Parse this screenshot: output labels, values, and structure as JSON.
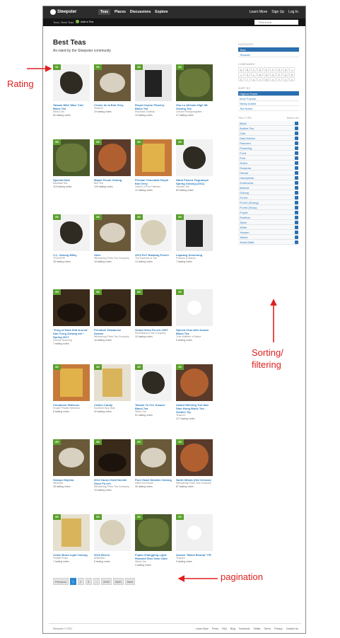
{
  "header": {
    "logo": "Steepster",
    "nav": [
      "Teas",
      "Places",
      "Discussions",
      "Explore"
    ],
    "user_nav": [
      "Learn More",
      "Sign Up",
      "Log In"
    ],
    "breadcrumb": "Teas / Best Teas",
    "add_tea": "Add a Tea",
    "search_placeholder": "Find a tea..."
  },
  "page": {
    "title": "Best Teas",
    "subtitle": "As rated by the Steepster community"
  },
  "teas": [
    {
      "rating": "91",
      "name": "Taiwan Wild 'Mao' Cha' Black Tea",
      "brand": "What-Cha",
      "notes": "60 tasting notes",
      "style": "t-leaf"
    },
    {
      "rating": "90",
      "name": "Creme de la Earl Grey",
      "brand": "Teavivre",
      "notes": "19 tasting notes",
      "style": "t-bowl"
    },
    {
      "rating": "89",
      "name": "Royal Ceylon Flowery Black Tea",
      "brand": "Elephant Chateau",
      "notes": "10 tasting notes",
      "style": "t-tin"
    },
    {
      "rating": "89",
      "name": "Zhu Lu Alishan High Mt. Oolong Tea",
      "brand": "Unicorn Rongcongskies",
      "notes": "27 tasting notes",
      "style": "t-green"
    },
    {
      "rating": "89",
      "name": "Special Dark",
      "brand": "Mandala Tea",
      "notes": "115 tasting notes",
      "style": "t-green"
    },
    {
      "rating": "89",
      "name": "Maple Pecan Oolong",
      "brand": "Bird Tea",
      "notes": "109 tasting notes",
      "style": "t-tea"
    },
    {
      "rating": "89",
      "name": "Persian Chocolate Royal Earl Grey",
      "brand": "Heart's of Tea Pakistan",
      "notes": "12 tasting notes",
      "style": "t-box"
    },
    {
      "rating": "89",
      "name": "Hand Picked Tieguanyin Spring Oolong (2011)",
      "brand": "Verdant Tea",
      "notes": "89 tasting notes",
      "style": "t-leaf"
    },
    {
      "rating": "89",
      "name": "J.C. Oolong Milky",
      "brand": "TEAVIVRE",
      "notes": "18 tasting notes",
      "style": "t-leaf"
    },
    {
      "rating": "89",
      "name": "Alice",
      "brand": "Whispering Pines Tea Company",
      "notes": "18 tasting notes",
      "style": "t-bowl"
    },
    {
      "rating": "89",
      "name": "2012 EoT Bastang Punch",
      "brand": "The Essence of Tea",
      "notes": "14 tasting notes",
      "style": "t-cake"
    },
    {
      "rating": "89",
      "name": "Lapsang Souchong",
      "brand": "Fortnum & Mason",
      "notes": "7 tasting notes",
      "style": "t-tin"
    },
    {
      "rating": "89",
      "name": "\"King of Dark Shit Aroma\" Dan Cong Oolong tea * Spring 2017",
      "brand": "Yunnan Sourcing",
      "notes": "7 tasting notes",
      "style": "t-dark"
    },
    {
      "rating": "89",
      "name": "Premium Taiwanese Assam",
      "brand": "Whispering Pines Tea Company",
      "notes": "18 tasting notes",
      "style": "t-dark"
    },
    {
      "rating": "89",
      "name": "Grand Shou Pu-erh 1997",
      "brand": "Red Blossom Tea Company",
      "notes": "10 tasting notes",
      "style": "t-dark"
    },
    {
      "rating": "89",
      "name": "Spiced Chai with Assam Black Tea",
      "brand": "Char Walletts of Maine",
      "notes": "5 tasting notes",
      "style": "t-blank"
    },
    {
      "rating": "89",
      "name": "Cinnamon Hibiscus",
      "brand": "Kroger Private Selection",
      "notes": "8 tasting notes",
      "style": "t-box"
    },
    {
      "rating": "89",
      "name": "Cotton Candy",
      "brand": "Southern Boy Teas",
      "notes": "30 tasting notes",
      "style": "t-pack"
    },
    {
      "rating": "89",
      "name": "Taiwan Yu Chi 'Assam' Black Tea",
      "brand": "What-Cha",
      "notes": "51 tasting notes",
      "style": "t-leaf"
    },
    {
      "rating": "89",
      "name": "Award Winning Yun Nan Dian Hong Black Tea - Golden Tip",
      "brand": "Teavivre",
      "notes": "117 tasting notes",
      "style": "t-tea"
    },
    {
      "rating": "89",
      "name": "Gokujo Hojicha",
      "brand": "Hibiscuts",
      "notes": "28 tasting notes",
      "style": "t-bowl"
    },
    {
      "rating": "89",
      "name": "2012 Huron Gold Needle Shou Pu-erh",
      "brand": "Whispering Pines Tea Company",
      "notes": "15 tasting notes",
      "style": "t-dark"
    },
    {
      "rating": "89",
      "name": "Pure Heart Shizhen Oolong",
      "brand": "Adita Tea House",
      "notes": "30 tasting notes",
      "style": "t-bowl"
    },
    {
      "rating": "89",
      "name": "North Winds (Old Version)",
      "brand": "Whispering Pines Tea Company",
      "notes": "87 tasting notes",
      "style": "t-tea"
    },
    {
      "rating": "89",
      "name": "Crane Bond Light Oolong",
      "brand": "Temple Road",
      "notes": "7 tasting notes",
      "style": "t-pack"
    },
    {
      "rating": "89",
      "name": "2016 Beech",
      "brand": "white2tea",
      "notes": "6 tasting notes",
      "style": "t-cake"
    },
    {
      "rating": "89",
      "name": "Fujian Zhangping Light Roasted Shui Xian Cake",
      "brand": "What-Cha",
      "notes": "3 tasting notes",
      "style": "t-green"
    },
    {
      "rating": "89",
      "name": "Assam \"Black Beauty\" FR",
      "brand": "Teapure",
      "notes": "9 tasting notes",
      "style": "t-blank"
    }
  ],
  "sidebar": {
    "category_head": "CATEGORY",
    "categories": [
      {
        "label": "Teas",
        "active": true
      },
      {
        "label": "Teaware",
        "active": false
      }
    ],
    "companies_head": "COMPANIES",
    "letters": [
      "A",
      "B",
      "C",
      "D",
      "E",
      "F",
      "G",
      "H",
      "I",
      "J",
      "K",
      "L",
      "M",
      "N",
      "O",
      "P",
      "Q",
      "R",
      "S",
      "T",
      "U",
      "V",
      "W",
      "X",
      "Y",
      "Z",
      "#"
    ],
    "sort_head": "SORT BY",
    "sort": [
      {
        "label": "Highest Rated",
        "active": true
      },
      {
        "label": "Most Popular",
        "active": false
      },
      {
        "label": "Newly Added",
        "active": false
      },
      {
        "label": "Tea Name",
        "active": false
      }
    ],
    "type_head": "TEA TYPE",
    "select_all": "Select All",
    "types": [
      "Black",
      "Bubble Tea",
      "Chai",
      "Dark Mocha",
      "Flavored",
      "Flowering",
      "Food",
      "Fruit",
      "Green",
      "Guayusa",
      "Herbal",
      "Honeybush",
      "Kombucha",
      "Matcha",
      "Oolong",
      "Pu'erh",
      "Pu'erh (Sheng)",
      "Pu'erh (Shou)",
      "Purple",
      "Rooibos",
      "Spice",
      "White",
      "Yaupon",
      "Yellow",
      "Yerba Maté"
    ]
  },
  "pagination": {
    "previous": "Previous",
    "pages": [
      "1",
      "2",
      "3",
      "...",
      "2039",
      "2040"
    ],
    "current": "1",
    "next": "Next"
  },
  "footer": {
    "copyright": "Steepster © 2021",
    "links": [
      "Learn More",
      "Press",
      "FAQ",
      "Blog",
      "Facebook",
      "Twitter",
      "Terms",
      "Privacy",
      "Contact Us"
    ]
  },
  "annotations": {
    "rating": "Rating",
    "sorting_line1": "Sorting/",
    "sorting_line2": "filtering",
    "pagination": "pagination",
    "color": "#e02020"
  }
}
